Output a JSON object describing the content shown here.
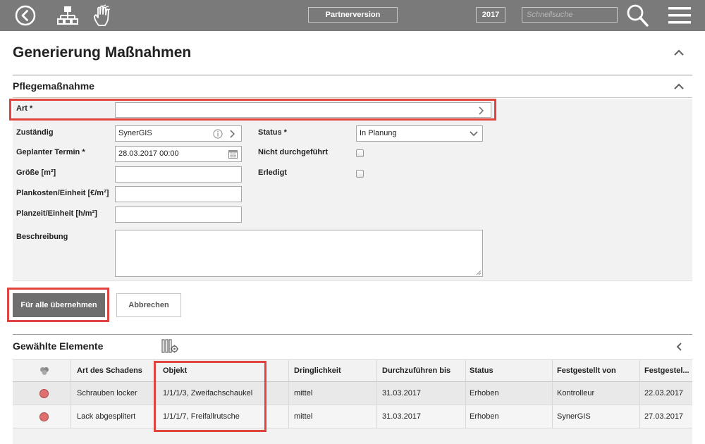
{
  "topbar": {
    "partner_label": "Partnerversion",
    "year": "2017",
    "search_placeholder": "Schnellsuche"
  },
  "page": {
    "title": "Generierung Maßnahmen"
  },
  "section_measure": {
    "title": "Pflegemaßnahme",
    "fields": {
      "art_label": "Art *",
      "art_value": "",
      "zustaendig_label": "Zuständig",
      "zustaendig_value": "SynerGIS",
      "termin_label": "Geplanter Termin *",
      "termin_value": "28.03.2017 00:00",
      "groesse_label": "Größe [m²]",
      "groesse_value": "",
      "plankosten_label": "Plankosten/Einheit [€/m²]",
      "plankosten_value": "",
      "planzeit_label": "Planzeit/Einheit [h/m²]",
      "planzeit_value": "",
      "beschreibung_label": "Beschreibung",
      "beschreibung_value": "",
      "status_label": "Status *",
      "status_value": "In Planung",
      "nicht_durchgefuehrt_label": "Nicht durchgeführt",
      "nicht_durchgefuehrt_checked": false,
      "erledigt_label": "Erledigt",
      "erledigt_checked": false
    }
  },
  "actions": {
    "apply_all_label": "Für alle übernehmen",
    "cancel_label": "Abbrechen"
  },
  "section_selected": {
    "title": "Gewählte Elemente",
    "columns": [
      "Art des Schadens",
      "Objekt",
      "Dringlichkeit",
      "Durchzuführen bis",
      "Status",
      "Festgestellt von",
      "Festgestel..."
    ],
    "rows": [
      [
        "Schrauben locker",
        "1/1/1/3, Zweifachschaukel",
        "mittel",
        "31.03.2017",
        "Erhoben",
        "Kontrolleur",
        "22.03.2017"
      ],
      [
        "Lack abgesplitert",
        "1/1/1/7, Freifallrutsche",
        "mittel",
        "31.03.2017",
        "Erhoben",
        "SynerGIS",
        "27.03.2017"
      ]
    ],
    "row_status_color": "#e07070"
  },
  "colors": {
    "topbar": "#7a7a7a",
    "highlight": "#e0443f",
    "primary_button": "#6e6e6e"
  }
}
